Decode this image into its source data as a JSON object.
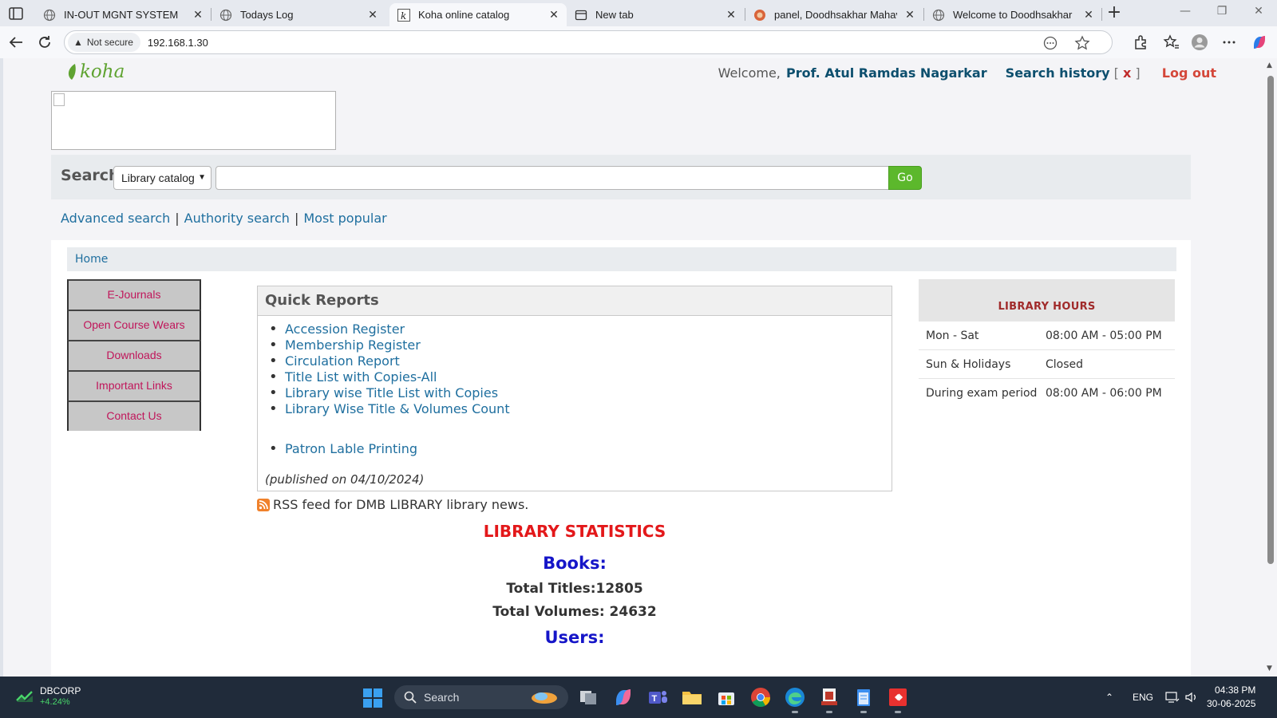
{
  "browser": {
    "tabs": [
      {
        "label": "IN-OUT MGNT SYSTEM",
        "active": false,
        "favicon": "globe-icon"
      },
      {
        "label": "Todays Log",
        "active": false,
        "favicon": "globe-icon"
      },
      {
        "label": "Koha online catalog",
        "active": true,
        "favicon": "koha-k-icon"
      },
      {
        "label": "New tab",
        "active": false,
        "favicon": "newtab-icon"
      },
      {
        "label": "panel, Doodhsakhar Mahavidy",
        "active": false,
        "favicon": "college-crest-icon"
      },
      {
        "label": "Welcome to Doodhsakhar Mal",
        "active": false,
        "favicon": "globe-icon"
      }
    ],
    "security_label": "Not secure",
    "url": "192.168.1.30"
  },
  "header": {
    "logo_text": "koha",
    "welcome_prefix": "Welcome,",
    "user_name": "Prof. Atul Ramdas Nagarkar",
    "search_history_label": "Search history",
    "history_bracket_open": "[",
    "history_clear": "x",
    "history_bracket_close": "]",
    "logout_label": "Log out"
  },
  "search": {
    "label": "Search",
    "scope_selected": "Library catalog",
    "query_value": "",
    "go_label": "Go"
  },
  "more_searches": {
    "advanced": "Advanced search",
    "authority": "Authority search",
    "popular": "Most popular",
    "separator": "|"
  },
  "breadcrumb": {
    "home": "Home"
  },
  "left_nav": [
    "E-Journals",
    "Open Course Wears",
    "Downloads",
    "Important Links",
    "Contact Us"
  ],
  "quick_reports": {
    "title": "Quick Reports",
    "items": [
      "Accession Register",
      "Membership Register",
      "Circulation Report",
      "Title List with Copies-All",
      "Library wise Title List with Copies",
      "Library Wise Title & Volumes Count",
      "Patron Lable Printing"
    ],
    "published": "(published on 04/10/2024)"
  },
  "rss_text": "RSS feed for DMB LIBRARY library news.",
  "statistics": {
    "title": "LIBRARY STATISTICS",
    "books_heading": "Books:",
    "total_titles": "Total Titles:12805",
    "total_volumes": "Total Volumes: 24632",
    "users_heading": "Users:"
  },
  "library_hours": {
    "title": "LIBRARY HOURS",
    "rows": [
      {
        "day": "Mon - Sat",
        "time": "08:00 AM - 05:00 PM"
      },
      {
        "day": "Sun & Holidays",
        "time": "Closed"
      },
      {
        "day": "During exam period",
        "time": "08:00 AM - 06:00 PM"
      }
    ]
  },
  "taskbar": {
    "stock_name": "DBCORP",
    "stock_change": "+4.24%",
    "search_placeholder": "Search",
    "language": "ENG",
    "time": "04:38 PM",
    "date": "30-06-2025"
  },
  "colors": {
    "koha_green": "#5fa331",
    "link_blue": "#1f6f9f",
    "nav_text": "#c0155a",
    "stats_red": "#e3181a",
    "stats_blue": "#1515c8",
    "go_green": "#5cb82c"
  }
}
